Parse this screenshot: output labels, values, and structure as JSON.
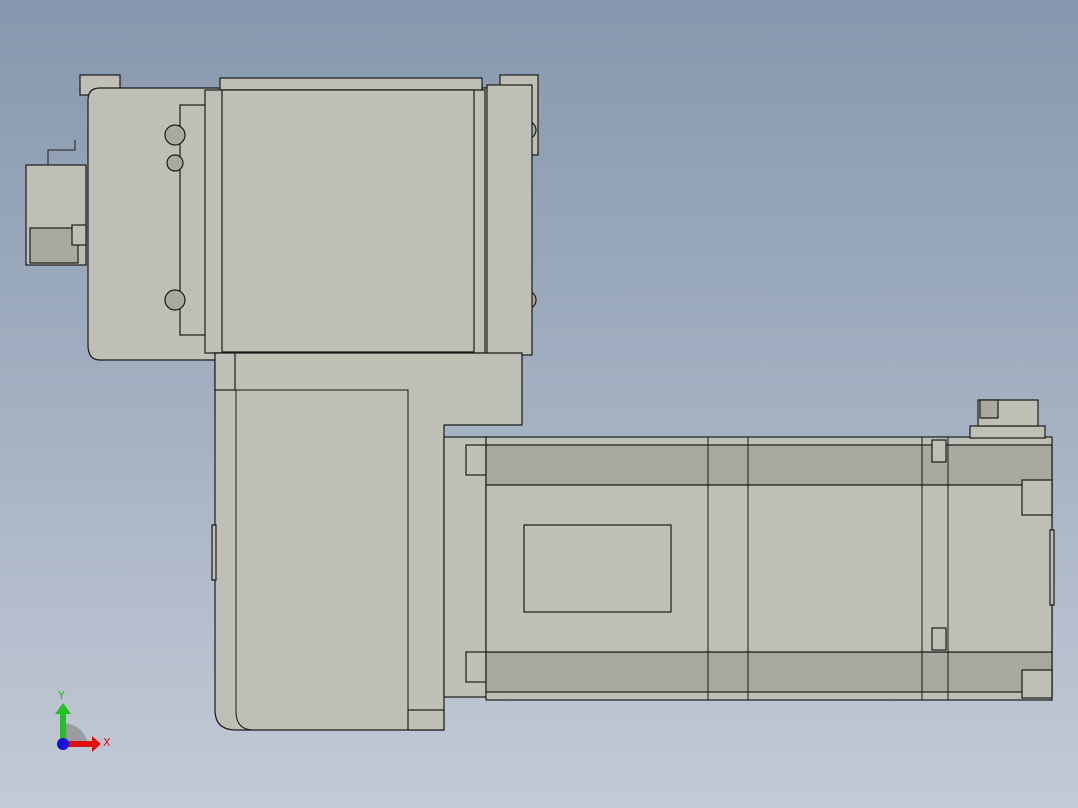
{
  "viewport": {
    "background_top": "#8797ad",
    "background_bottom": "#c4cad6",
    "part_color": "#bfbfb5"
  },
  "triad": {
    "x_label": "X",
    "y_label": "Y",
    "x_color": "#e01010",
    "y_color": "#20c020",
    "z_color": "#1010e0"
  }
}
